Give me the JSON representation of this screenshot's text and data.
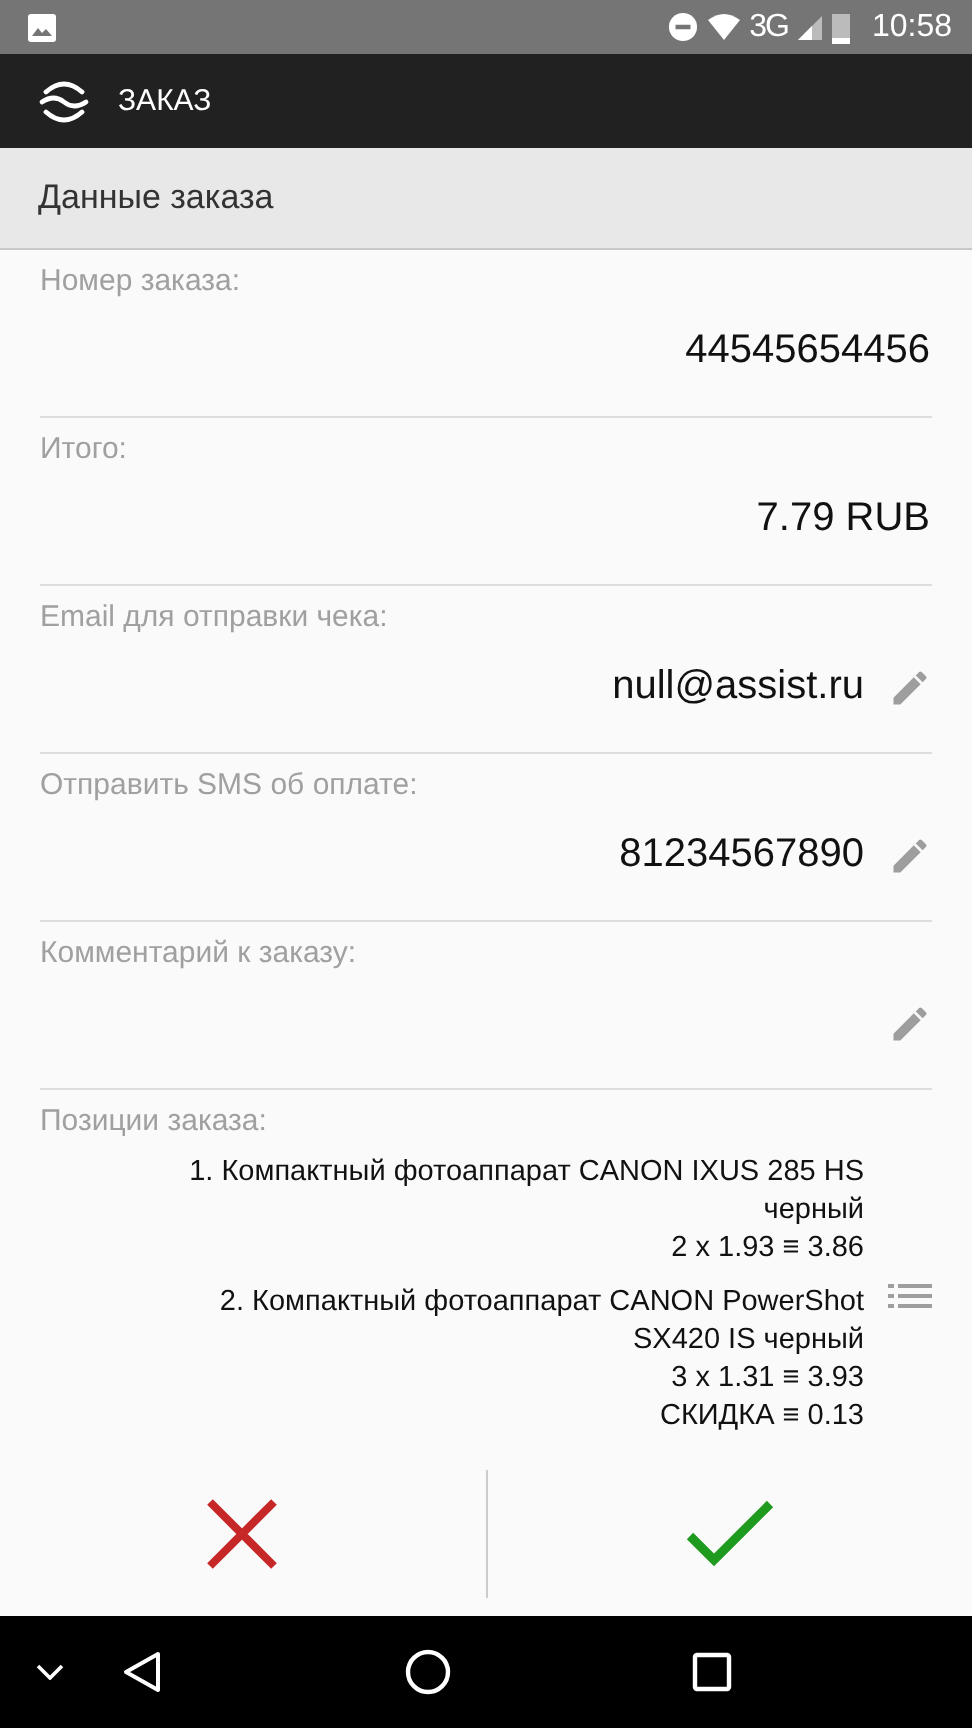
{
  "status_bar": {
    "time": "10:58",
    "network": "3G"
  },
  "app_bar": {
    "title": "ЗАКАЗ"
  },
  "section": {
    "title": "Данные заказа"
  },
  "fields": [
    {
      "label": "Номер заказа:",
      "value": "44545654456",
      "editable": false
    },
    {
      "label": "Итого:",
      "value": "7.79 RUB",
      "editable": false
    },
    {
      "label": "Email для отправки чека:",
      "value": "null@assist.ru",
      "editable": true
    },
    {
      "label": "Отправить SMS об оплате:",
      "value": "81234567890",
      "editable": true
    },
    {
      "label": "Комментарий к заказу:",
      "editable": true
    }
  ],
  "positions": {
    "label": "Позиции заказа:",
    "items": [
      {
        "lines": [
          "1. Компактный фотоаппарат CANON IXUS 285 HS",
          "черный",
          "2 x 1.93 ≡ 3.86"
        ]
      },
      {
        "lines": [
          "2. Компактный фотоаппарат CANON PowerShot",
          "SX420 IS черный",
          "3 x 1.31 ≡ 3.93",
          "СКИДКА ≡ 0.13"
        ]
      }
    ]
  }
}
